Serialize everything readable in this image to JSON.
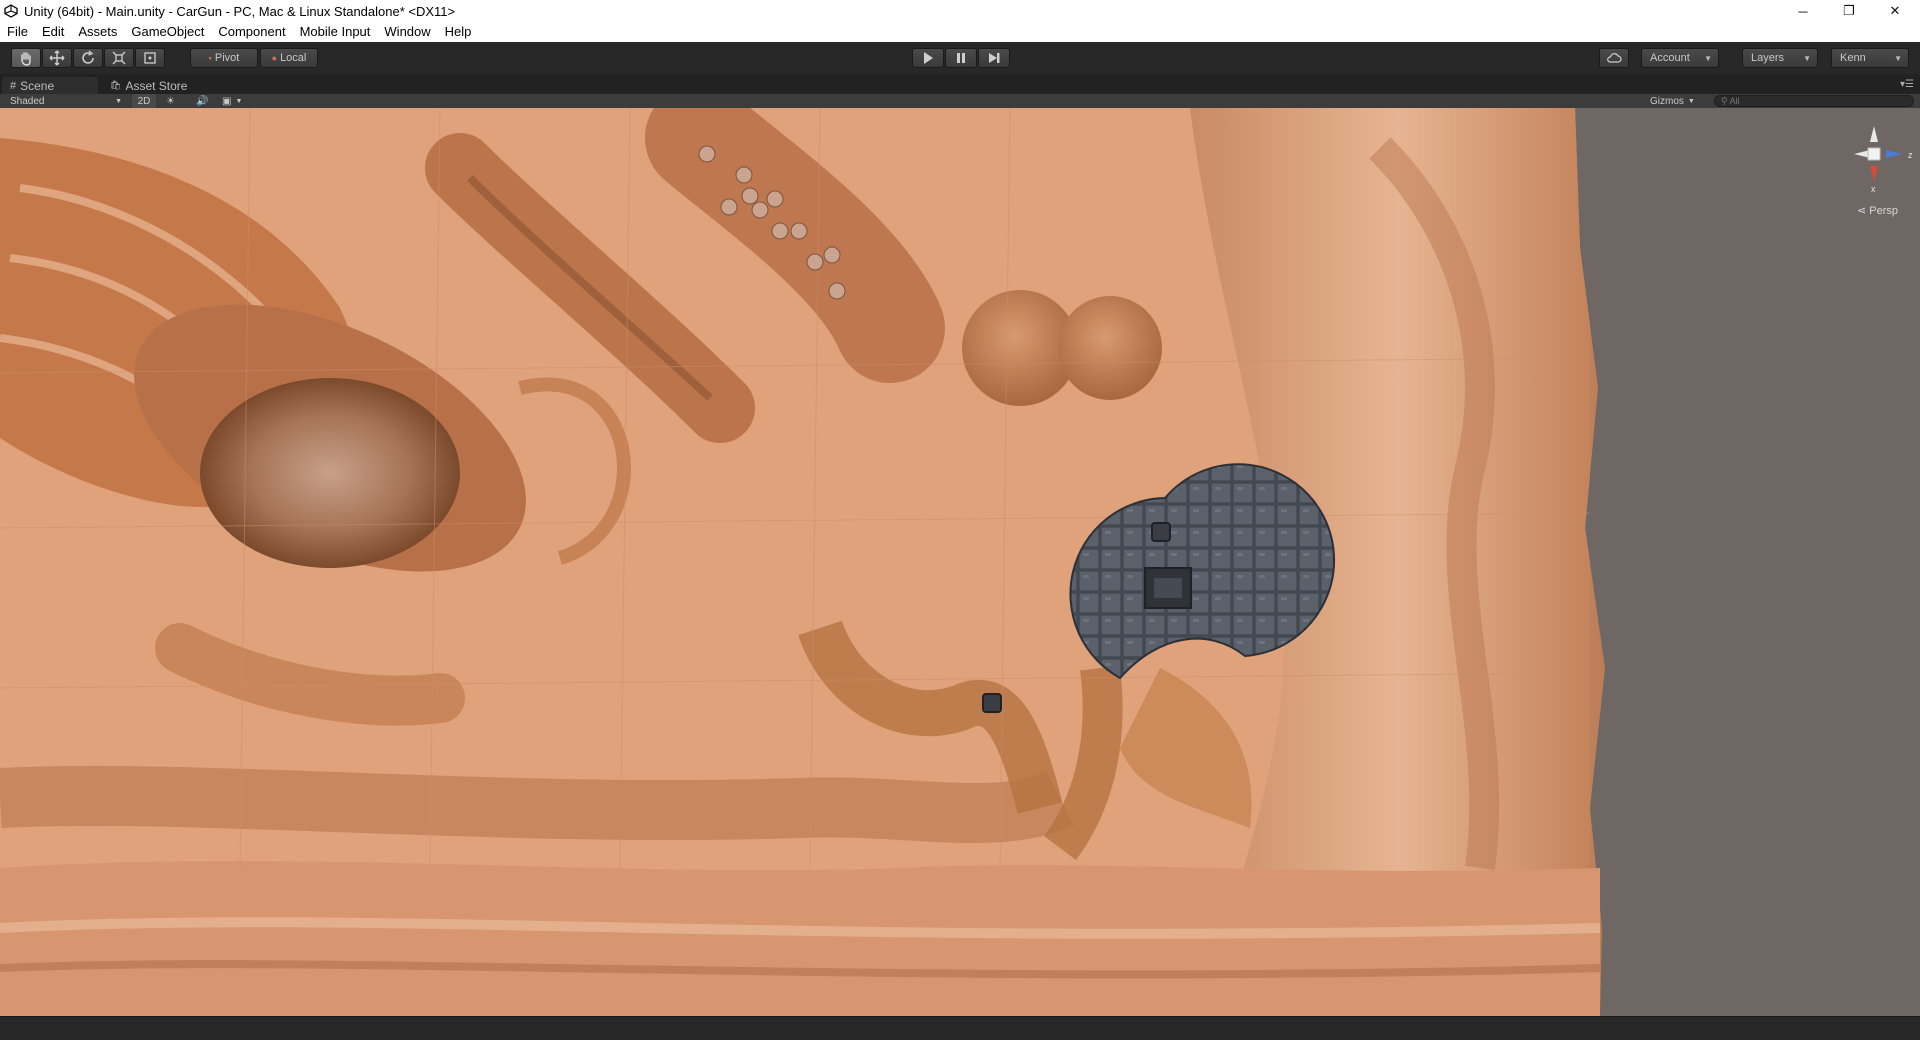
{
  "window": {
    "title": "Unity (64bit) - Main.unity - CarGun - PC, Mac & Linux Standalone* <DX11>",
    "controls": {
      "minimize": "─",
      "maximize": "❐",
      "close": "✕"
    }
  },
  "menu": {
    "items": [
      "File",
      "Edit",
      "Assets",
      "GameObject",
      "Component",
      "Mobile Input",
      "Window",
      "Help"
    ]
  },
  "toolbar": {
    "tools": [
      "hand-icon",
      "move-icon",
      "rotate-icon",
      "scale-icon",
      "rect-icon"
    ],
    "pivot_label": "Pivot",
    "local_label": "Local",
    "account_label": "Account",
    "layers_label": "Layers",
    "layout_label": "Kenn"
  },
  "tabs": {
    "scene_label": "Scene",
    "asset_store_label": "Asset Store"
  },
  "scenebar": {
    "shading_mode": "Shaded",
    "mode_2d": "2D",
    "gizmos_label": "Gizmos",
    "search_placeholder": "All"
  },
  "gizmo": {
    "z_label": "z",
    "x_label": "x",
    "projection_label": "Persp"
  },
  "colors": {
    "terrain": "#e0a27a",
    "terrain_dark": "#b86a3a",
    "background": "#6f6763",
    "chrome": "#282828"
  }
}
